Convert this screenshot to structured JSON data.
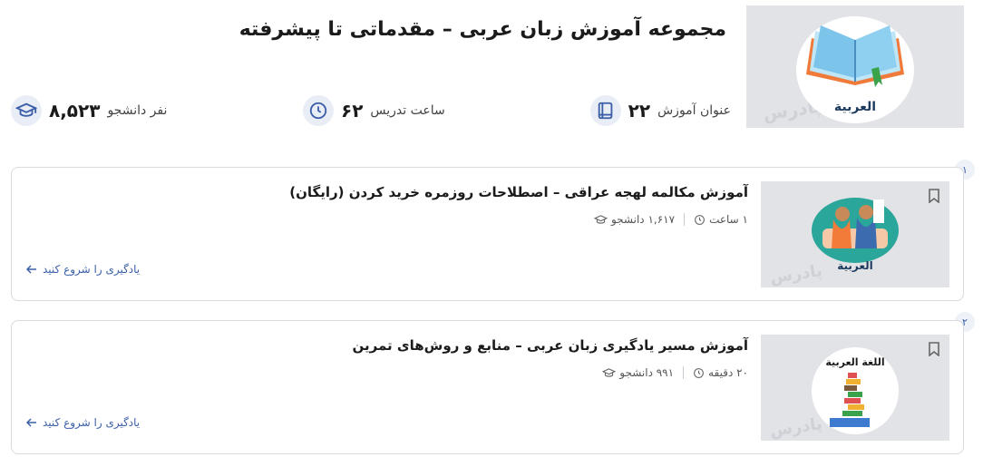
{
  "header": {
    "title": "مجموعه آموزش زبان عربی – مقدماتی تا پیشرفته",
    "image_label": "العربية",
    "watermark": "پادرس"
  },
  "stats": [
    {
      "number": "۲۲",
      "label": "عنوان آموزش",
      "icon": "book-icon"
    },
    {
      "number": "۶۲",
      "label": "ساعت تدریس",
      "icon": "clock-icon"
    },
    {
      "number": "۸,۵۲۳",
      "label": "نفر دانشجو",
      "icon": "graduation-cap-icon"
    }
  ],
  "courses": [
    {
      "index": "۱",
      "title": "آموزش مکالمه لهجه عراقی – اصطلاحات روزمره خرید کردن (رایگان)",
      "students": "۱,۶۱۷ دانشجو",
      "duration": "۱ ساعت",
      "cta": "یادگیری را شروع کنید",
      "thumb_label": "العربية"
    },
    {
      "index": "۲",
      "title": "آموزش مسیر یادگیری زبان عربی – منابع و روش‌های تمرین",
      "students": "۹۹۱ دانشجو",
      "duration": "۲۰ دقیقه",
      "cta": "یادگیری را شروع کنید",
      "thumb_label": "اللغة العربية"
    }
  ],
  "colors": {
    "accent": "#3b5fa8",
    "icon_bg": "#e9edf6",
    "thumb_bg": "#e2e3e6"
  }
}
